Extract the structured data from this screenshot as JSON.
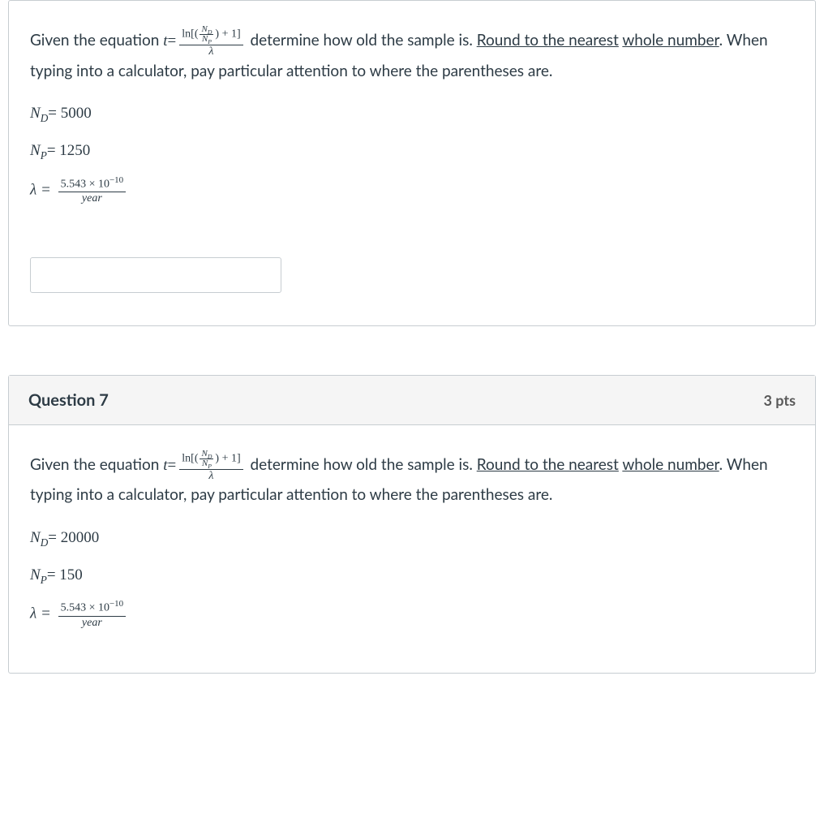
{
  "q6": {
    "prompt_lead": "Given the equation ",
    "prompt_mid": " determine how old the sample is. ",
    "prompt_underline1": "Round to the nearest",
    "prompt_underline2": "whole number",
    "prompt_tail": ". When typing into a calculator, pay particular attention to where the parentheses are.",
    "nd_label": "N",
    "nd_sub": "D",
    "nd_val": "= 5000",
    "np_label": "N",
    "np_sub": "P",
    "np_val": "= 1250",
    "lambda_label": "λ =",
    "lambda_num": "5.543 × 10",
    "lambda_exp": "−10",
    "lambda_den": "year",
    "formula": {
      "t": "t",
      "eq": " = ",
      "ln": "ln",
      "nd": "N",
      "nd_sub": "D",
      "np": "N",
      "np_sub": "P",
      "plus1": " + 1",
      "den": "λ"
    }
  },
  "q7": {
    "title": "Question 7",
    "points": "3 pts",
    "prompt_lead": "Given the equation ",
    "prompt_mid": " determine how old the sample is. ",
    "prompt_underline1": "Round to the nearest",
    "prompt_underline2": "whole number",
    "prompt_tail": ". When typing into a calculator, pay particular attention to where the parentheses are.",
    "nd_label": "N",
    "nd_sub": "D",
    "nd_val": "= 20000",
    "np_label": "N",
    "np_sub": "P",
    "np_val": "= 150",
    "lambda_label": "λ =",
    "lambda_num": "5.543 × 10",
    "lambda_exp": "−10",
    "lambda_den": "year",
    "formula": {
      "t": "t",
      "eq": " = ",
      "ln": "ln",
      "nd": "N",
      "nd_sub": "D",
      "np": "N",
      "np_sub": "P",
      "plus1": " + 1",
      "den": "λ"
    }
  }
}
